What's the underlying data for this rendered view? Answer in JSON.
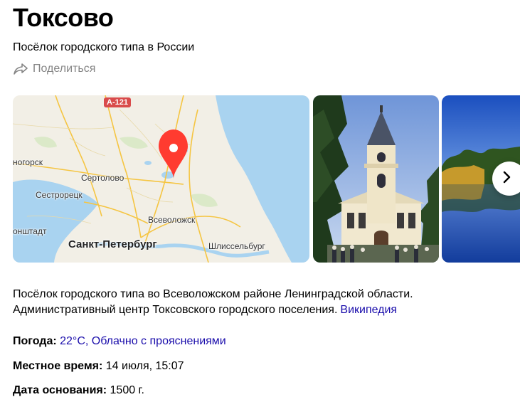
{
  "header": {
    "title": "Токсово",
    "subtitle": "Посёлок городского типа в России",
    "share_label": "Поделиться"
  },
  "map": {
    "road_badge": "А-121",
    "labels": {
      "sertolovo": "Сертолово",
      "sestroretsk": "Сестрорецк",
      "vsevolozhsk": "Всеволожск",
      "spb": "Санкт-Петербург",
      "shlisselburg": "Шлиссельбург",
      "nogorsk": "ногорск",
      "kronshtadt": "онштадт"
    },
    "colors": {
      "water": "#a9d3f0",
      "land": "#f2efe6",
      "pin": "#ff3b30"
    }
  },
  "description": {
    "text": "Посёлок городского типа во Всеволожском районе Ленинградской области. Административный центр Токсовского городского поселения.",
    "link_label": "Википедия"
  },
  "facts": {
    "weather_label": "Погода:",
    "weather_value": "22°C, Облачно с прояснениями",
    "time_label": "Местное время:",
    "time_value": "14 июля, 15:07",
    "founded_label": "Дата основания:",
    "founded_value": "1500 г."
  }
}
